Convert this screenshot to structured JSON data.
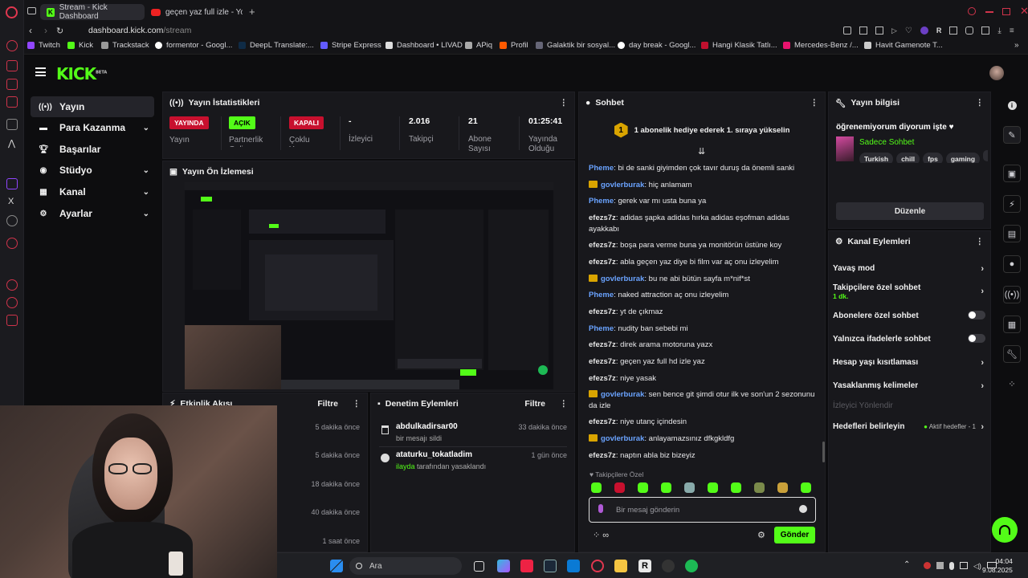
{
  "browser": {
    "tabs": [
      {
        "label": "Stream - Kick Dashboard"
      },
      {
        "label": "geçen yaz full izle - YouT"
      }
    ],
    "url_host": "dashboard.kick.com",
    "url_path": "/stream",
    "bookmarks": [
      "Twitch",
      "Kick",
      "Trackstack",
      "formentor - Googl...",
      "DeepL Translate:...",
      "Stripe Express",
      "Dashboard • LIVAD",
      "APiq",
      "Profil",
      "Galaktik bir sosyal...",
      "day break - Googl...",
      "Hangi Klasik Tatlı...",
      "Mercedes-Benz /...",
      "Havit Gamenote T..."
    ]
  },
  "app": {
    "logo": "KICK",
    "logo_beta": "BETA",
    "accent": "#53fc18"
  },
  "nav": {
    "items": [
      {
        "label": "Yayın"
      },
      {
        "label": "Para Kazanma"
      },
      {
        "label": "Başarılar"
      },
      {
        "label": "Stüdyo"
      },
      {
        "label": "Kanal"
      },
      {
        "label": "Ayarlar"
      }
    ]
  },
  "stats": {
    "title": "Yayın İstatistikleri",
    "items": [
      {
        "badge": "YAYINDA",
        "label": "Yayın"
      },
      {
        "badge": "AÇIK",
        "label": "Partnerlik Gelir"
      },
      {
        "badge": "KAPALI",
        "label": "Çoklu Yayın"
      },
      {
        "value": "-",
        "label": "İzleyici"
      },
      {
        "value": "2.016",
        "label": "Takipçi"
      },
      {
        "value": "21",
        "label": "Abone Sayısı"
      },
      {
        "value": "01:25:41",
        "label": "Yayında Olduğu"
      }
    ]
  },
  "preview": {
    "title": "Yayın Ön İzlemesi"
  },
  "activity": {
    "title": "Etkinlik Akışı",
    "filter": "Filtre",
    "times": [
      "5 dakika önce",
      "5 dakika önce",
      "18 dakika önce",
      "40 dakika önce",
      "1 saat önce"
    ]
  },
  "moderation": {
    "title": "Denetim Eylemleri",
    "filter": "Filtre",
    "items": [
      {
        "user": "abdulkadirsar00",
        "detail": "bir mesajı sildi",
        "time": "33 dakika önce"
      },
      {
        "user": "ataturku_tokatladim",
        "actor": "ilayda",
        "detail": "tarafından yasaklandı",
        "time": "1 gün önce"
      }
    ]
  },
  "chat": {
    "title": "Sohbet",
    "pin_rank": "1",
    "pin_text": "1 abonelik hediye ederek 1. sıraya yükselin",
    "messages": [
      {
        "user": "Pheme",
        "text": "bi de sanki giyimden çok tavır duruş da önemli sanki"
      },
      {
        "user": "govlerburak",
        "text": "hiç anlamam"
      },
      {
        "user": "Pheme",
        "text": "gerek var mı usta buna ya"
      },
      {
        "user": "efezs7z",
        "text": "adidas şapka adidas hırka adidas eşofman adidas ayakkabı"
      },
      {
        "user": "efezs7z",
        "text": "boşa para verme buna ya monitörün üstüne koy"
      },
      {
        "user": "efezs7z",
        "text": "abla geçen yaz diye bi film var aç onu izleyelim"
      },
      {
        "user": "govlerburak",
        "text": "bu ne abi bütün sayfa m*nif*st"
      },
      {
        "user": "Pheme",
        "text": "naked attraction aç onu izleyelim"
      },
      {
        "user": "efezs7z",
        "text": "yt de çıkmaz"
      },
      {
        "user": "Pheme",
        "text": "nudity ban sebebi mi"
      },
      {
        "user": "efezs7z",
        "text": "direk arama motoruna yazx"
      },
      {
        "user": "efezs7z",
        "text": "geçen yaz full hd izle yaz"
      },
      {
        "user": "efezs7z",
        "text": "niye yasak"
      },
      {
        "user": "govlerburak",
        "text": "sen bence git şimdi otur ilk ve son'un 2 sezonunu da izle"
      },
      {
        "user": "efezs7z",
        "text": "niye utanç içindesin"
      },
      {
        "user": "govlerburak",
        "text": "anlayamazsınız dfkgkldfg"
      },
      {
        "user": "efezs7z",
        "text": "naptın abla biz bizeyiz"
      }
    ],
    "emote_label": "Takipçilere Özel",
    "input_placeholder": "Bir mesaj gönderin",
    "send_label": "Gönder"
  },
  "stream_info": {
    "title": "Yayın bilgisi",
    "stream_title": "öğrenemiyorum diyorum işte ♥",
    "category": "Sadece Sohbet",
    "tags": [
      "Turkish",
      "chill",
      "fps",
      "gaming"
    ],
    "edit_label": "Düzenle"
  },
  "channel_actions": {
    "title": "Kanal Eylemleri",
    "slow_mode": "Yavaş mod",
    "followers_only": "Takipçilere özel sohbet",
    "followers_only_sub": "1 dk.",
    "subs_only": "Abonelere özel sohbet",
    "emotes_only": "Yalnızca ifadelerle sohbet",
    "age_restrict": "Hesap yaşı kısıtlaması",
    "banned_words": "Yasaklanmış kelimeler",
    "viewer_redirect": "İzleyici Yönlendir",
    "goals": "Hedefleri belirleyin",
    "goals_status": "Aktif hedefler - 1"
  },
  "taskbar": {
    "search_placeholder": "Ara",
    "time": "04:04",
    "date": "9.08.2025"
  }
}
